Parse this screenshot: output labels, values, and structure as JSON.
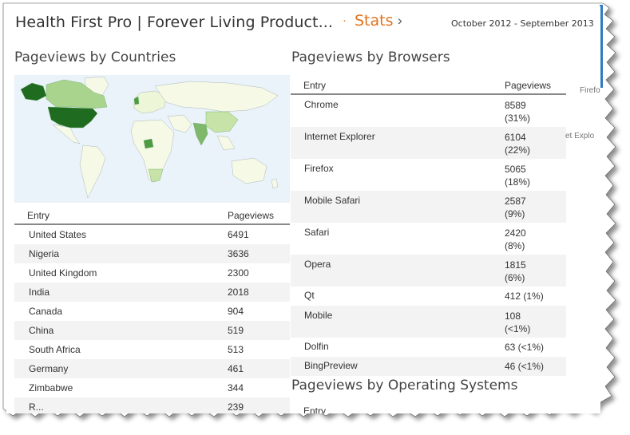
{
  "header": {
    "site_title": "Health First Pro | Forever Living Product...",
    "separator": "·",
    "section_link": "Stats",
    "chevron": "›",
    "date_range": "October 2012 - September 2013"
  },
  "countries": {
    "title": "Pageviews by Countries",
    "columns": [
      "Entry",
      "Pageviews"
    ],
    "rows": [
      {
        "entry": "United States",
        "pageviews": "6491"
      },
      {
        "entry": "Nigeria",
        "pageviews": "3636"
      },
      {
        "entry": "United Kingdom",
        "pageviews": "2300"
      },
      {
        "entry": "India",
        "pageviews": "2018"
      },
      {
        "entry": "Canada",
        "pageviews": "904"
      },
      {
        "entry": "China",
        "pageviews": "519"
      },
      {
        "entry": "South Africa",
        "pageviews": "513"
      },
      {
        "entry": "Germany",
        "pageviews": "461"
      },
      {
        "entry": "Zimbabwe",
        "pageviews": "344"
      },
      {
        "entry": "R...",
        "pageviews": "239"
      }
    ]
  },
  "browsers": {
    "title": "Pageviews by Browsers",
    "columns": [
      "Entry",
      "Pageviews"
    ],
    "rows": [
      {
        "entry": "Chrome",
        "count": "8589",
        "pct": "(31%)"
      },
      {
        "entry": "Internet Explorer",
        "count": "6104",
        "pct": "(22%)"
      },
      {
        "entry": "Firefox",
        "count": "5065",
        "pct": "(18%)"
      },
      {
        "entry": "Mobile Safari",
        "count": "2587",
        "pct": "(9%)"
      },
      {
        "entry": "Safari",
        "count": "2420",
        "pct": "(8%)"
      },
      {
        "entry": "Opera",
        "count": "1815",
        "pct": "(6%)"
      },
      {
        "entry": "Qt",
        "count": "412 (1%)",
        "pct": ""
      },
      {
        "entry": "Mobile",
        "count": "108",
        "pct": "(<1%)"
      },
      {
        "entry": "Dolfin",
        "count": "63 (<1%)",
        "pct": ""
      },
      {
        "entry": "BingPreview",
        "count": "46 (<1%)",
        "pct": ""
      }
    ],
    "pie_legend": [
      "Firefox",
      "et Explo"
    ]
  },
  "os": {
    "title": "Pageviews by Operating Systems",
    "partial_header": "Entry"
  },
  "colors": {
    "accent": "#e0731b",
    "frame_blue": "#2f7bc0",
    "map_water": "#eaf2fa",
    "map_high": "#1f6b1f",
    "map_mid": "#4f9a45",
    "map_low": "#a9d48d",
    "map_base": "#f6f9e6"
  }
}
